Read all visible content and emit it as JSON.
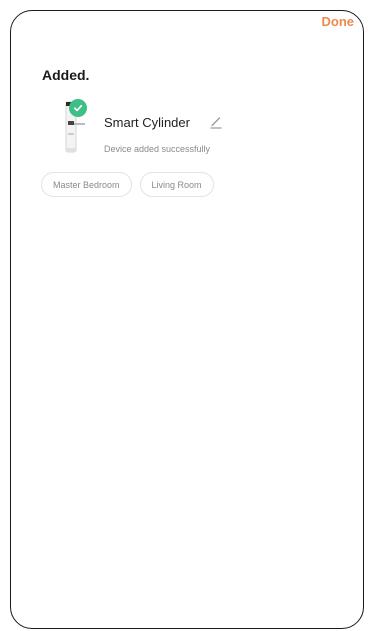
{
  "header": {
    "done_label": "Done"
  },
  "main": {
    "heading": "Added.",
    "device": {
      "name": "Smart Cylinder",
      "status": "Device added successfully",
      "status_icon": "check-circle-icon"
    },
    "rooms": [
      {
        "label": "Master Bedroom"
      },
      {
        "label": "Living Room"
      }
    ]
  },
  "colors": {
    "accent": "#f08a4b",
    "success": "#3fbf88",
    "text_primary": "#1a1a1a",
    "text_secondary": "#8a8a8a"
  }
}
